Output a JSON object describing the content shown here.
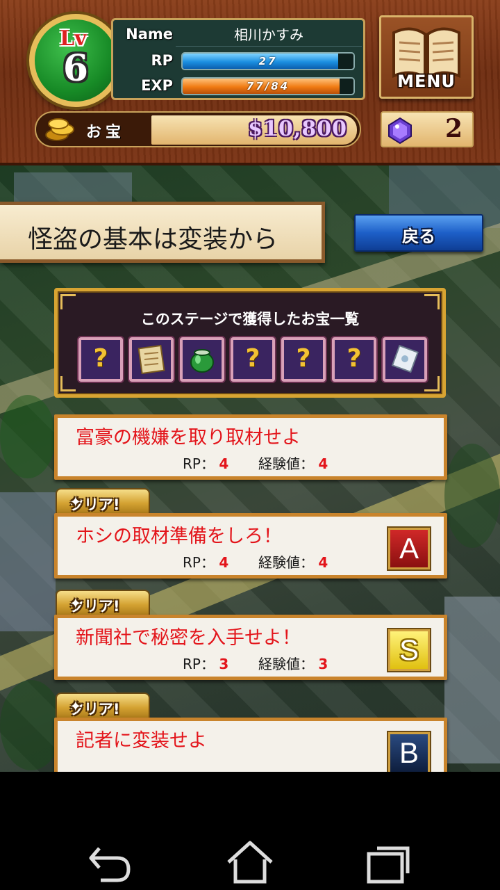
{
  "header": {
    "level_label": "Lv",
    "level_value": "6",
    "name_label": "Name",
    "name_value": "相川かすみ",
    "rp_label": "RP",
    "rp_text": "27",
    "rp_fill_fraction": 0.91,
    "exp_label": "EXP",
    "exp_text": "77/84",
    "exp_fill_fraction": 0.92,
    "menu_label": "MENU",
    "treasure_label": "お宝",
    "treasure_value": "$10,800",
    "gem_count": "2"
  },
  "stage": {
    "title": "怪盗の基本は変装から",
    "back_label": "戻る"
  },
  "treasures": {
    "title": "このステージで獲得したお宝一覧",
    "items": [
      {
        "icon": "unknown-treasure-icon",
        "text": "?"
      },
      {
        "icon": "scroll-treasure-icon",
        "text": ""
      },
      {
        "icon": "jar-treasure-icon",
        "text": ""
      },
      {
        "icon": "unknown-treasure-icon",
        "text": "?"
      },
      {
        "icon": "unknown-treasure-icon",
        "text": "?"
      },
      {
        "icon": "unknown-treasure-icon",
        "text": "?"
      },
      {
        "icon": "card-treasure-icon",
        "text": ""
      }
    ]
  },
  "missions": [
    {
      "title": "富豪の機嫌を取り取材せよ",
      "rp_label": "RP：",
      "rp": "4",
      "exp_label": "経験値：",
      "exp": "4",
      "clear": "",
      "rank": ""
    },
    {
      "title": "ホシの取材準備をしろ！",
      "rp_label": "RP：",
      "rp": "4",
      "exp_label": "経験値：",
      "exp": "4",
      "clear": "クリア!",
      "rank": "A"
    },
    {
      "title": "新聞社で秘密を入手せよ！",
      "rp_label": "RP：",
      "rp": "3",
      "exp_label": "経験値：",
      "exp": "3",
      "clear": "クリア!",
      "rank": "S"
    },
    {
      "title": "記者に変装せよ",
      "rp_label": "",
      "rp": "",
      "exp_label": "",
      "exp": "",
      "clear": "クリア!",
      "rank": "B"
    }
  ],
  "colors": {
    "accent_red": "#e3151b",
    "rank_A": "#b01818",
    "rank_S": "#f0d018",
    "rank_B": "#16305a",
    "gold": "#d8a432"
  },
  "navbar": {
    "icons": [
      "back-icon",
      "home-icon",
      "recent-apps-icon"
    ]
  }
}
